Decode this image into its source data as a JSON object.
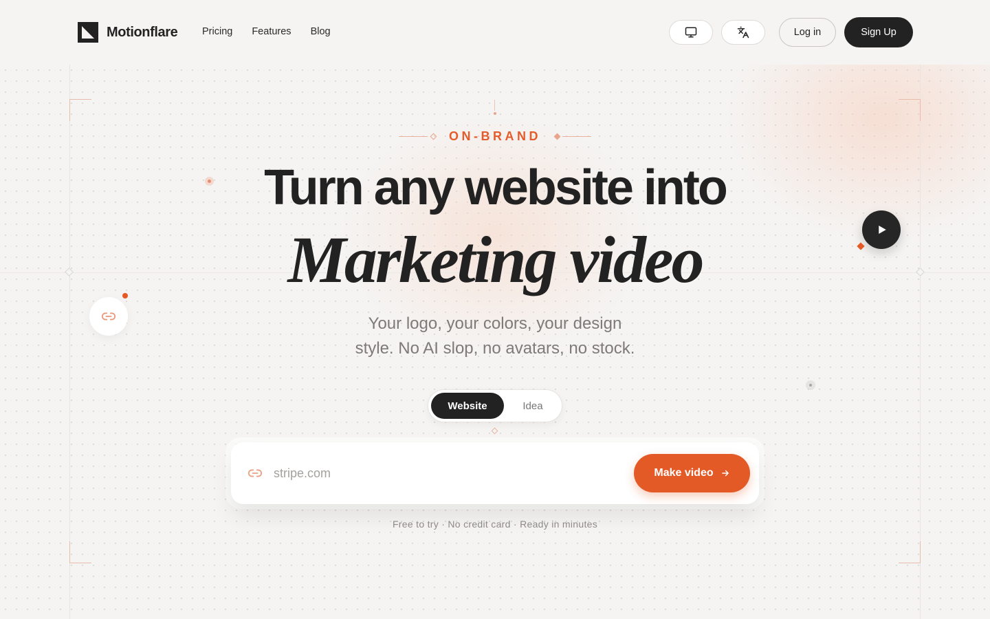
{
  "brand": {
    "name": "Motionflare"
  },
  "nav": {
    "items": [
      "Pricing",
      "Features",
      "Blog"
    ]
  },
  "header": {
    "display_icon": "monitor-icon",
    "language_icon": "translate-icon",
    "login_label": "Log in",
    "signup_label": "Sign Up"
  },
  "hero": {
    "eyebrow": "ON-BRAND",
    "title_line1": "Turn any website into",
    "title_line2": "Marketing video",
    "subtitle_line1": "Your logo, your colors, your design",
    "subtitle_line2": "style. No AI slop, no avatars, no stock."
  },
  "mode_toggle": {
    "active": "Website",
    "inactive": "Idea"
  },
  "url_input": {
    "placeholder": "stripe.com",
    "value": ""
  },
  "cta": {
    "label": "Make video"
  },
  "footnote": "Free to try · No credit card · Ready in minutes",
  "colors": {
    "accent": "#e45a26",
    "dark": "#222222",
    "background": "#f5f4f3",
    "muted_text": "#7d7a77"
  }
}
